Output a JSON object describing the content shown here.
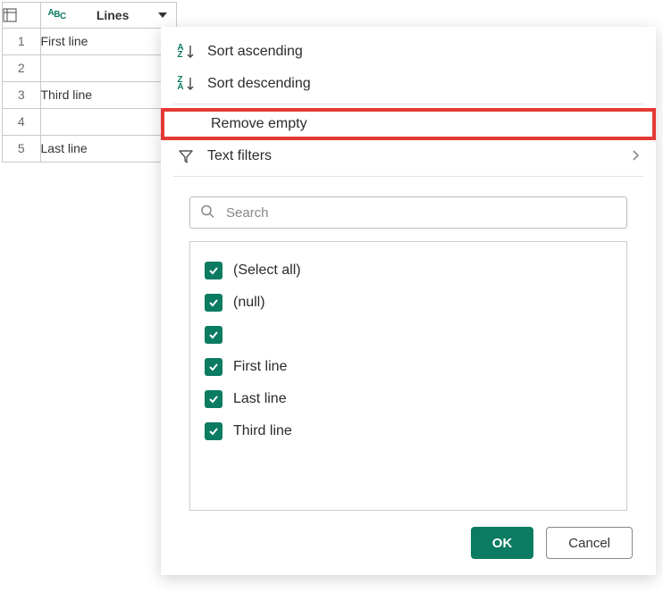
{
  "column": {
    "name": "Lines",
    "type_icon": "ABC"
  },
  "rows": [
    {
      "idx": "1",
      "value": "First line"
    },
    {
      "idx": "2",
      "value": ""
    },
    {
      "idx": "3",
      "value": "Third line"
    },
    {
      "idx": "4",
      "value": ""
    },
    {
      "idx": "5",
      "value": "Last line"
    }
  ],
  "menu": {
    "sort_asc": "Sort ascending",
    "sort_desc": "Sort descending",
    "remove_empty": "Remove empty",
    "text_filters": "Text filters"
  },
  "search": {
    "placeholder": "Search"
  },
  "filter_items": [
    {
      "label": "(Select all)"
    },
    {
      "label": "(null)"
    },
    {
      "label": ""
    },
    {
      "label": "First line"
    },
    {
      "label": "Last line"
    },
    {
      "label": "Third line"
    }
  ],
  "buttons": {
    "ok": "OK",
    "cancel": "Cancel"
  }
}
